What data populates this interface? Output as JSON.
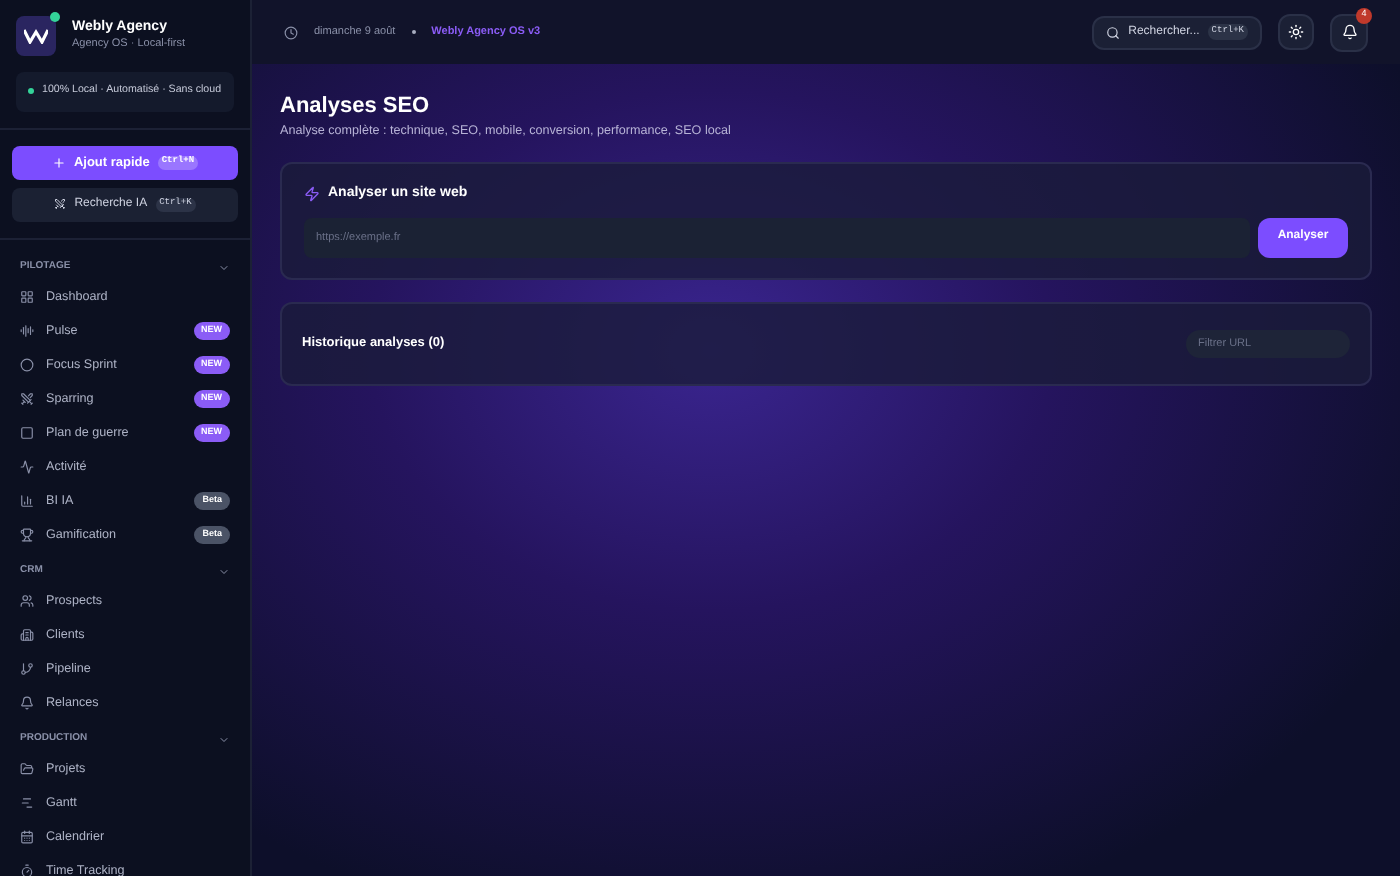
{
  "brand": {
    "name": "Webly Agency",
    "subtitle": "Agency OS · Local-first",
    "status": "100% Local · Automatisé · Sans cloud"
  },
  "quick_add": {
    "label": "Ajout rapide",
    "shortcut": "Ctrl+N"
  },
  "ai_search": {
    "label": "Recherche IA",
    "shortcut": "Ctrl+K"
  },
  "sections": [
    {
      "title": "PILOTAGE",
      "expanded": true,
      "items": [
        {
          "label": "Dashboard"
        },
        {
          "label": "Pulse",
          "badge": {
            "text": "NEW",
            "color": "#8b5cf6"
          }
        },
        {
          "label": "Focus Sprint",
          "badge": {
            "text": "NEW",
            "color": "#8b5cf6"
          }
        },
        {
          "label": "Sparring",
          "badge": {
            "text": "NEW",
            "color": "#8b5cf6"
          }
        },
        {
          "label": "Plan de guerre",
          "badge": {
            "text": "NEW",
            "color": "#8b5cf6"
          }
        },
        {
          "label": "Activité"
        },
        {
          "label": "BI IA",
          "badge": {
            "text": "Beta",
            "color": "#4b5366"
          }
        },
        {
          "label": "Gamification",
          "badge": {
            "text": "Beta",
            "color": "#4b5366"
          }
        }
      ]
    },
    {
      "title": "CRM",
      "expanded": true,
      "items": [
        {
          "label": "Prospects"
        },
        {
          "label": "Clients"
        },
        {
          "label": "Pipeline"
        },
        {
          "label": "Relances"
        }
      ]
    },
    {
      "title": "PRODUCTION",
      "expanded": true,
      "items": [
        {
          "label": "Projets"
        },
        {
          "label": "Gantt"
        },
        {
          "label": "Calendrier"
        },
        {
          "label": "Time Tracking"
        }
      ]
    }
  ],
  "topbar": {
    "date": "dimanche 9 août",
    "version": "Webly Agency OS v3",
    "search": "Rechercher...",
    "search_shortcut": "Ctrl+K",
    "notifications": "4"
  },
  "page": {
    "title": "Analyses SEO",
    "subtitle": "Analyse complète : technique, SEO, mobile, conversion, performance, SEO local"
  },
  "analyze": {
    "title": "Analyser un site web",
    "placeholder": "https://exemple.fr",
    "button": "Analyser"
  },
  "history": {
    "title": "Historique analyses (0)",
    "filter_placeholder": "Filtrer URL"
  }
}
